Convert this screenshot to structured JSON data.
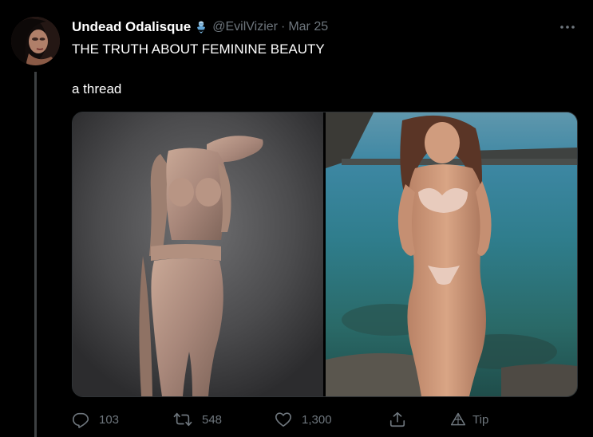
{
  "tweet": {
    "author": {
      "display_name": "Undead Odalisque",
      "name_emoji": "genie-emoji",
      "handle": "@EvilVizier",
      "separator": "·",
      "date": "Mar 25"
    },
    "text_line1": "THE TRUTH ABOUT FEMININE BEAUTY",
    "text_line2": "a thread",
    "media": [
      {
        "description_icon": "statue-photo"
      },
      {
        "description_icon": "beach-photo"
      }
    ],
    "actions": {
      "reply_count": "103",
      "retweet_count": "548",
      "like_count": "1,300",
      "tip_label": "Tip"
    }
  },
  "colors": {
    "background": "#000000",
    "primary_text": "#ffffff",
    "secondary_text": "#6e767d",
    "thread_line": "#3d4042",
    "border": "#2f3336"
  },
  "icons": {
    "more": "more-horizontal-icon",
    "reply": "reply-icon",
    "retweet": "retweet-icon",
    "like": "heart-icon",
    "share": "share-icon",
    "tip": "tip-icon"
  }
}
